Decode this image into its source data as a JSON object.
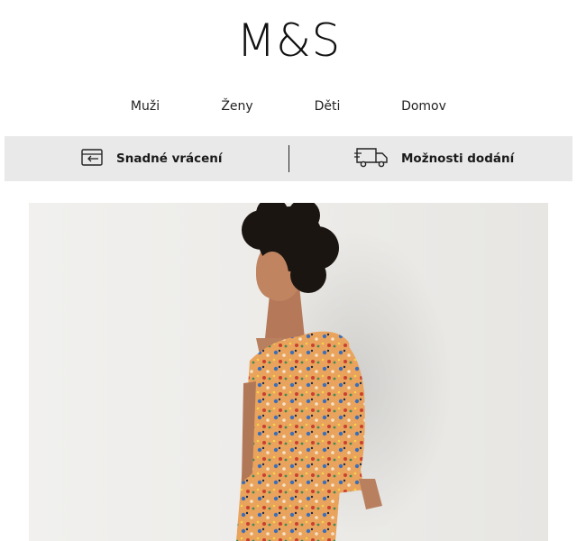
{
  "brand": {
    "logo_text": "M&S"
  },
  "nav": {
    "items": [
      {
        "label": "Muži"
      },
      {
        "label": "Ženy"
      },
      {
        "label": "Děti"
      },
      {
        "label": "Domov"
      }
    ]
  },
  "banner": {
    "returns_label": "Snadné vrácení",
    "returns_icon": "return-box-icon",
    "delivery_label": "Možnosti dodání",
    "delivery_icon": "delivery-truck-icon"
  },
  "hero": {
    "image": "model-floral-dress-photo"
  },
  "colors": {
    "banner_bg": "#e9e9e9",
    "text": "#111111",
    "dress_base": "#e7a15a"
  }
}
